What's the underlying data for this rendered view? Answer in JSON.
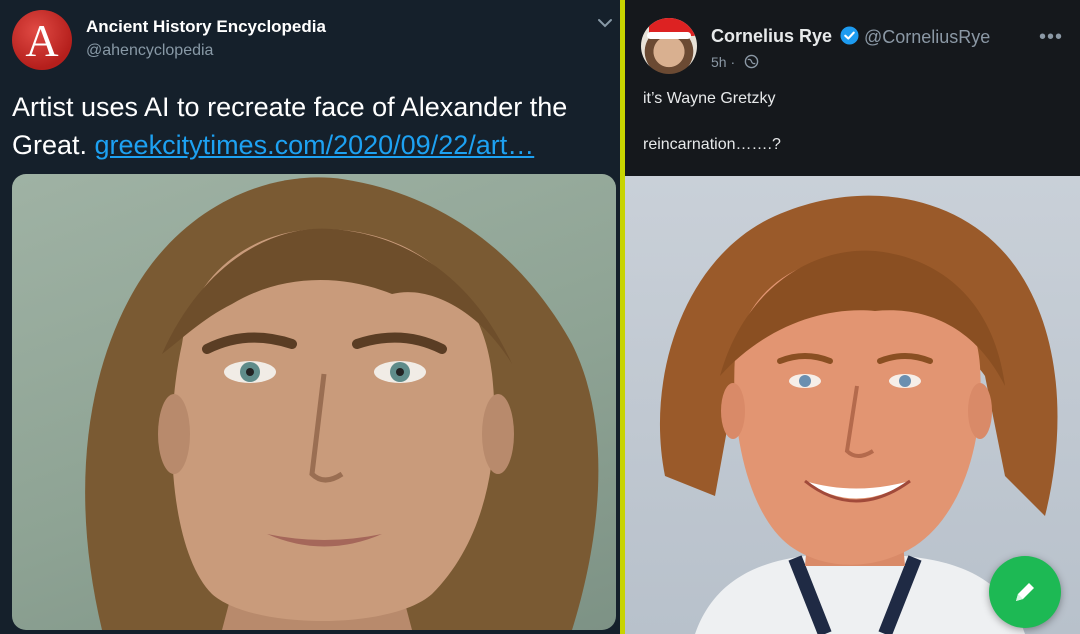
{
  "left_tweet": {
    "account_name": "Ancient History Encyclopedia",
    "handle": "@ahencyclopedia",
    "logo_letter": "A",
    "text": "Artist uses AI to recreate face of Alexander the Great. ",
    "link_text": "greekcitytimes.com/2020/09/22/art…",
    "menu_icon": "chevron-down-icon",
    "media_description_icon": "portrait-image"
  },
  "right_tweet": {
    "display_name": "Cornelius Rye",
    "handle": "@CorneliusRye",
    "timestamp": "5h",
    "separator": "·",
    "line1": "it’s Wayne Gretzky",
    "line2": "reincarnation…….?",
    "more_label": "•••",
    "verified_icon": "verified-badge-icon",
    "globe_icon": "globe-icon",
    "compose_icon": "pencil-icon"
  },
  "colors": {
    "left_bg": "#15202b",
    "right_bg": "#15181c",
    "divider": "#c8d400",
    "link": "#1da1f2",
    "verified": "#1d9bf0",
    "fab": "#1db954"
  }
}
